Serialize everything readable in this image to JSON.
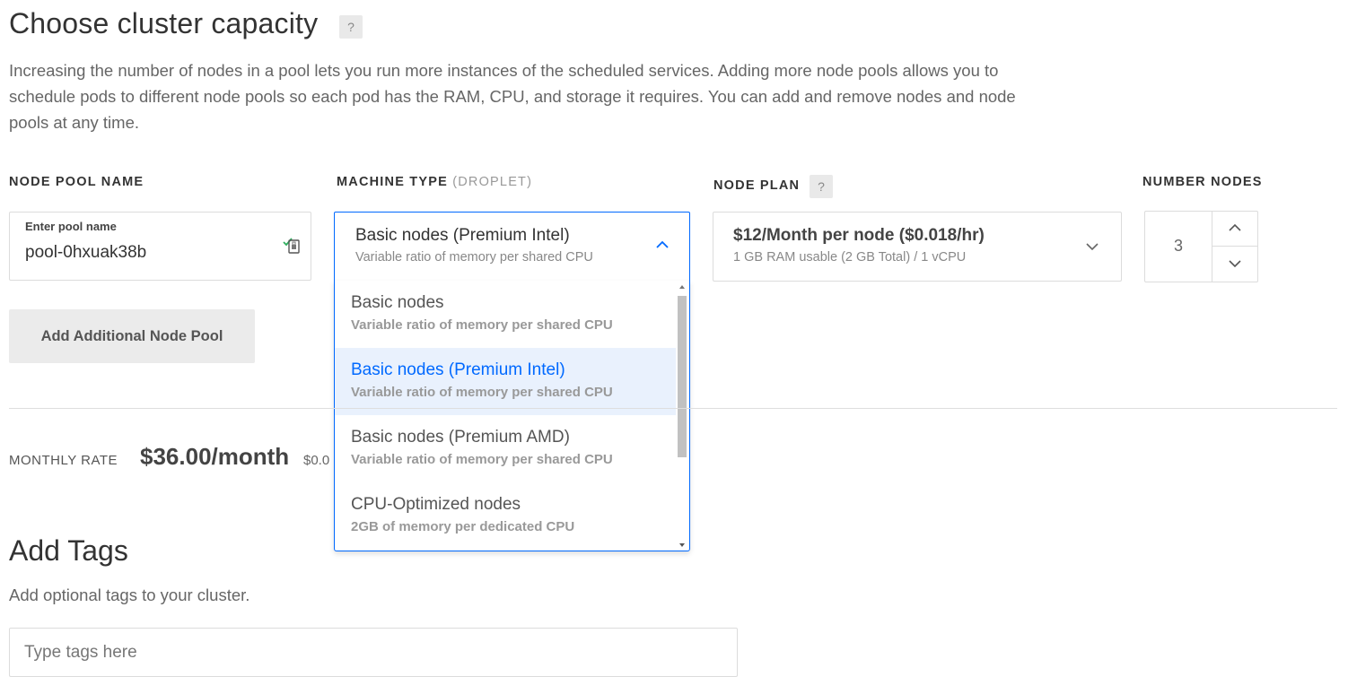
{
  "capacity": {
    "title": "Choose cluster capacity",
    "help": "?",
    "description": "Increasing the number of nodes in a pool lets you run more instances of the scheduled services. Adding more node pools allows you to schedule pods to different node pools so each pod has the RAM, CPU, and storage it requires. You can add and remove nodes and node pools at any time."
  },
  "columns": {
    "pool_name": "NODE POOL NAME",
    "machine_type": "MACHINE TYPE",
    "machine_type_muted": "(DROPLET)",
    "node_plan": "NODE PLAN",
    "node_plan_help": "?",
    "number_nodes": "NUMBER NODES"
  },
  "pool": {
    "label": "Enter pool name",
    "value": "pool-0hxuak38b"
  },
  "add_pool_button": "Add Additional Node Pool",
  "machine_select": {
    "selected_title": "Basic nodes (Premium Intel)",
    "selected_subtitle": "Variable ratio of memory per shared CPU",
    "options": [
      {
        "title": "Basic nodes",
        "subtitle": "Variable ratio of memory per shared CPU"
      },
      {
        "title": "Basic nodes (Premium Intel)",
        "subtitle": "Variable ratio of memory per shared CPU"
      },
      {
        "title": "Basic nodes (Premium AMD)",
        "subtitle": "Variable ratio of memory per shared CPU"
      },
      {
        "title": "CPU-Optimized nodes",
        "subtitle": "2GB of memory per dedicated CPU"
      }
    ]
  },
  "plan_select": {
    "title": "$12/Month per node ($0.018/hr)",
    "subtitle": "1 GB RAM usable (2 GB Total) / 1 vCPU"
  },
  "node_count": "3",
  "rate": {
    "label": "MONTHLY RATE",
    "value": "$36.00/month",
    "hourly": "$0.0"
  },
  "tags": {
    "title": "Add Tags",
    "description": "Add optional tags to your cluster.",
    "placeholder": "Type tags here"
  },
  "colors": {
    "accent": "#0069ff",
    "selected_bg": "#e9f1fd"
  }
}
